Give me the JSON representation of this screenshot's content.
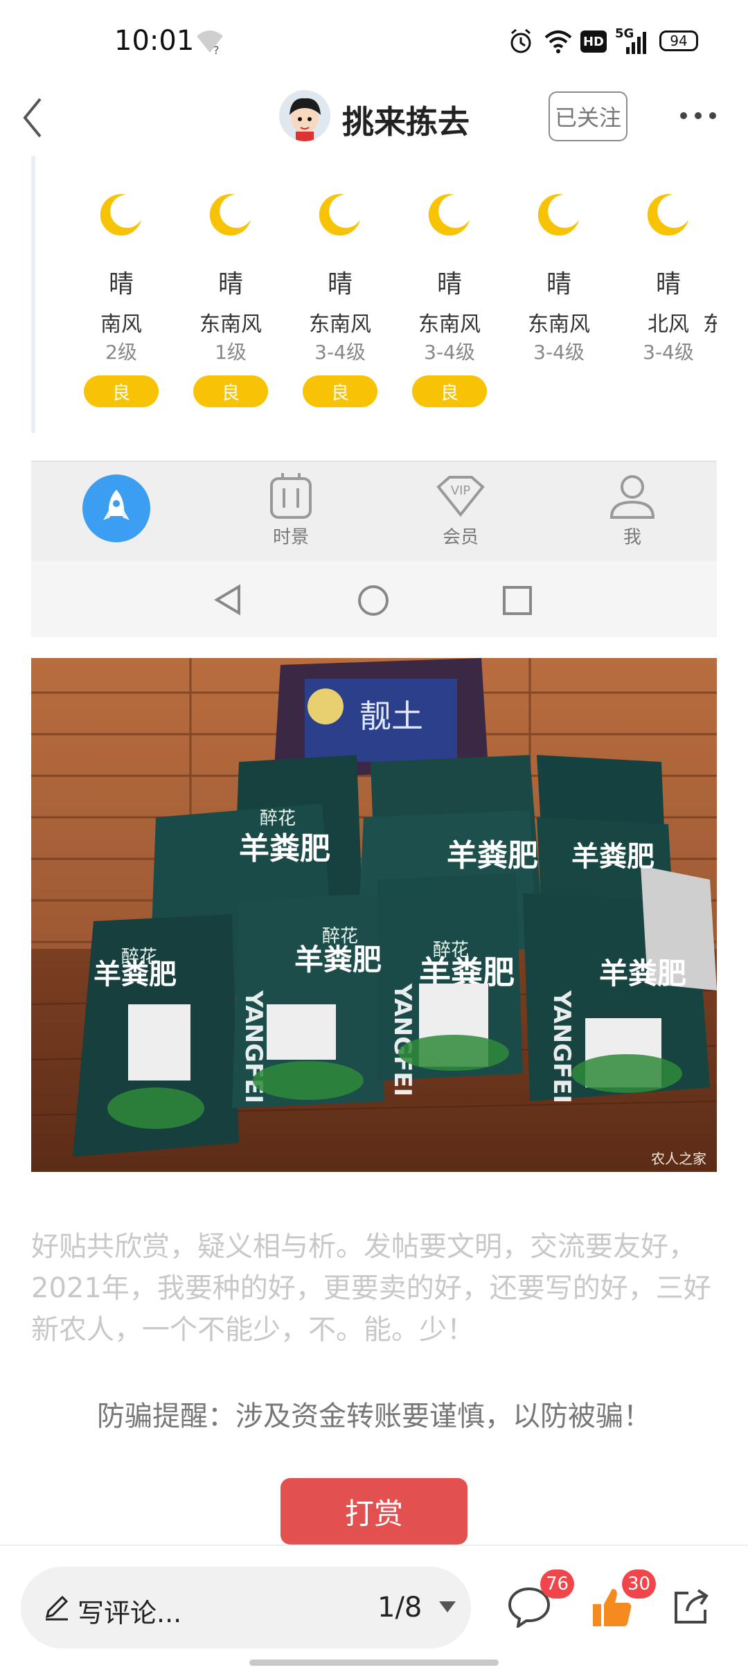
{
  "status_bar": {
    "time": "10:01",
    "battery": "94",
    "network": "5G",
    "hd": "HD"
  },
  "header": {
    "author": "挑来拣去",
    "follow_label": "已关注"
  },
  "weather": {
    "days": [
      {
        "condition": "晴",
        "wind": "南风",
        "level": "2级",
        "aqi": "良"
      },
      {
        "condition": "晴",
        "wind": "东南风",
        "level": "1级",
        "aqi": "良"
      },
      {
        "condition": "晴",
        "wind": "东南风",
        "level": "3-4级",
        "aqi": "良"
      },
      {
        "condition": "晴",
        "wind": "东南风",
        "level": "3-4级",
        "aqi": "良"
      },
      {
        "condition": "晴",
        "wind": "东南风",
        "level": "3-4级",
        "aqi": ""
      },
      {
        "condition": "晴",
        "wind": "北风",
        "level": "3-4级",
        "aqi": ""
      }
    ],
    "partial_next": "东"
  },
  "embedded_nav": {
    "items": [
      {
        "label": ""
      },
      {
        "label": "时景"
      },
      {
        "label": "会员"
      },
      {
        "label": "我"
      }
    ],
    "vip_text": "VIP"
  },
  "photo": {
    "bag_brand": "羊粪肥",
    "bag_sub": "醉花",
    "bag_latin": "YANGFEI",
    "top_bag": "靓土",
    "watermark": "农人之家"
  },
  "post": {
    "text": "好贴共欣赏，疑义相与析。发帖要文明，交流要友好，2021年，我要种的好，更要卖的好，还要写的好，三好新农人，一个不能少，不。能。少！",
    "warning": "防骗提醒：涉及资金转账要谨慎，以防被骗！",
    "reward_label": "打赏"
  },
  "bottom_bar": {
    "comment_placeholder": "写评论...",
    "page_indicator": "1/8",
    "comment_count": "76",
    "like_count": "30"
  },
  "colors": {
    "aqi": "#f8c305",
    "reward": "#e35050",
    "badge": "#f0464b",
    "like": "#f58a1f"
  }
}
